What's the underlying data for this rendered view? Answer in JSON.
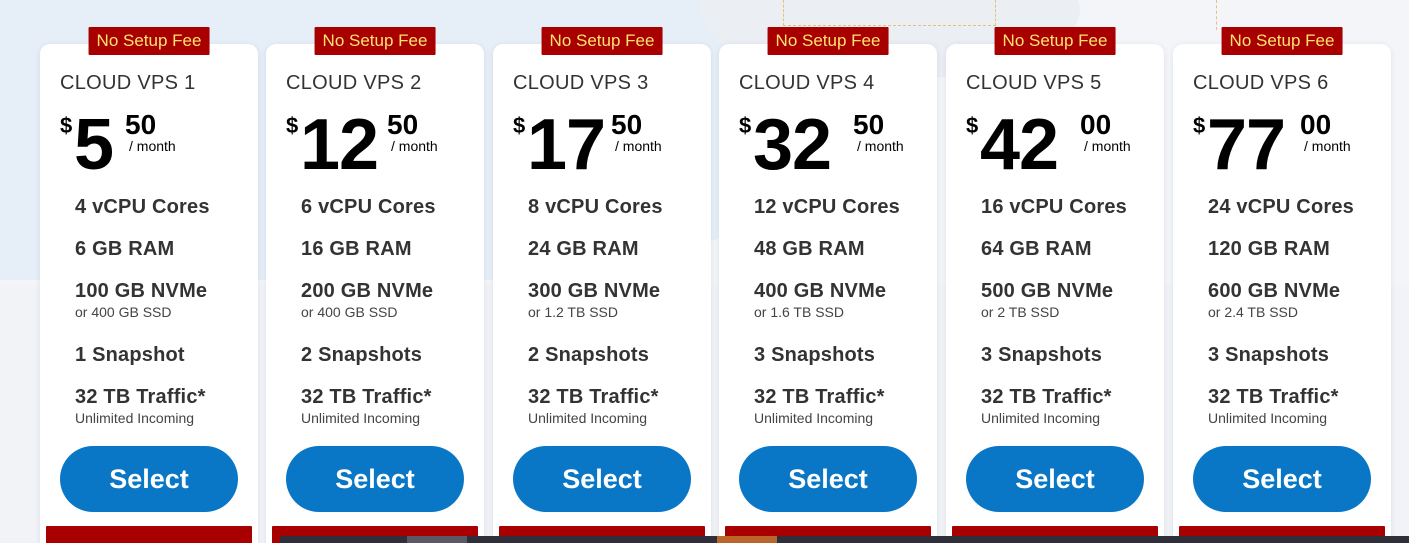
{
  "badge_label": "No Setup Fee",
  "select_label": "Select",
  "currency": "$",
  "per_label": "/ month",
  "colors": {
    "badge_bg": "#a80000",
    "badge_text": "#ffe36e",
    "button": "#0977c6"
  },
  "plans": [
    {
      "name": "CLOUD VPS 1",
      "price_whole": "5",
      "price_cents": "50",
      "cpu": "4 vCPU Cores",
      "ram": "6 GB RAM",
      "storage": "100 GB NVMe",
      "storage_alt": "or 400 GB SSD",
      "snapshots": "1 Snapshot",
      "traffic": "32 TB Traffic*",
      "traffic_note": "Unlimited Incoming"
    },
    {
      "name": "CLOUD VPS 2",
      "price_whole": "12",
      "price_cents": "50",
      "cpu": "6 vCPU Cores",
      "ram": "16 GB RAM",
      "storage": "200 GB NVMe",
      "storage_alt": "or 400 GB SSD",
      "snapshots": "2 Snapshots",
      "traffic": "32 TB Traffic*",
      "traffic_note": "Unlimited Incoming"
    },
    {
      "name": "CLOUD VPS 3",
      "price_whole": "17",
      "price_cents": "50",
      "cpu": "8 vCPU Cores",
      "ram": "24 GB RAM",
      "storage": "300 GB NVMe",
      "storage_alt": "or 1.2 TB SSD",
      "snapshots": "2 Snapshots",
      "traffic": "32 TB Traffic*",
      "traffic_note": "Unlimited Incoming"
    },
    {
      "name": "CLOUD VPS 4",
      "price_whole": "32",
      "price_cents": "50",
      "cpu": "12 vCPU Cores",
      "ram": "48 GB RAM",
      "storage": "400 GB NVMe",
      "storage_alt": "or 1.6 TB SSD",
      "snapshots": "3 Snapshots",
      "traffic": "32 TB Traffic*",
      "traffic_note": "Unlimited Incoming"
    },
    {
      "name": "CLOUD VPS 5",
      "price_whole": "42",
      "price_cents": "00",
      "cpu": "16 vCPU Cores",
      "ram": "64 GB RAM",
      "storage": "500 GB NVMe",
      "storage_alt": "or 2 TB SSD",
      "snapshots": "3 Snapshots",
      "traffic": "32 TB Traffic*",
      "traffic_note": "Unlimited Incoming"
    },
    {
      "name": "CLOUD VPS 6",
      "price_whole": "77",
      "price_cents": "00",
      "cpu": "24 vCPU Cores",
      "ram": "120 GB RAM",
      "storage": "600 GB NVMe",
      "storage_alt": "or 2.4 TB SSD",
      "snapshots": "3 Snapshots",
      "traffic": "32 TB Traffic*",
      "traffic_note": "Unlimited Incoming"
    }
  ]
}
